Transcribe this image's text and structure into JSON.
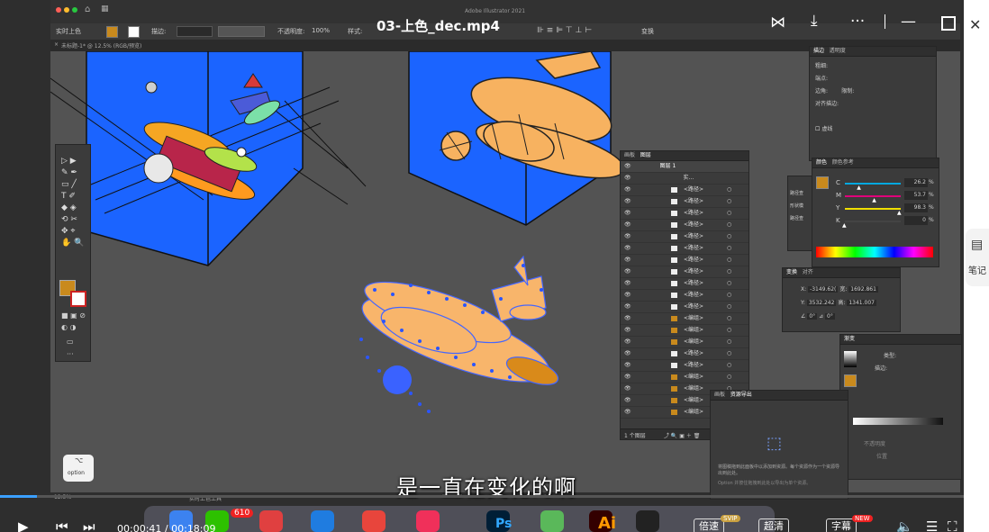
{
  "video": {
    "title": "03-上色_dec.mp4",
    "subtitle": "是一直在变化的啊",
    "time_current": "00:00:41",
    "time_total": "00:18:09",
    "progress": 0.038,
    "buttons": {
      "speed": "倍速",
      "quality": "超清",
      "quality_badge": "SVIP",
      "caption": "字幕",
      "caption_badge": "NEW"
    },
    "side_label": "笔记"
  },
  "illustrator": {
    "app_title": "Adobe Illustrator 2021",
    "control_bar": {
      "tool_label": "实时上色",
      "stroke_label": "描边:",
      "opacity_label": "不透明度:",
      "opacity_value": "100%",
      "style_label": "样式:",
      "transform_label": "变换"
    },
    "doc_tab": "未标题-1* @ 12.5% (RGB/预览)",
    "zoom": "12.5%",
    "status_tool": "实时上色工具",
    "layers_panel": {
      "tabs": [
        "画板",
        "图层"
      ],
      "top_layer": "图层 1",
      "sub_layer": "实...",
      "rows": [
        "<路径>",
        "<路径>",
        "<路径>",
        "<路径>",
        "<路径>",
        "<路径>",
        "<路径>",
        "<路径>",
        "<路径>",
        "<路径>",
        "<路径>",
        "<编组>",
        "<编组>",
        "<编组>",
        "<路径>",
        "<路径>",
        "<编组>",
        "<编组>",
        "<编组>",
        "<编组>"
      ],
      "footer": "1 个图层"
    },
    "color_panel": {
      "tabs": [
        "颜色",
        "颜色参考"
      ],
      "channels": [
        {
          "label": "C",
          "value": "26.2",
          "color": "#00a8e0"
        },
        {
          "label": "M",
          "value": "53.7",
          "color": "#e0007a"
        },
        {
          "label": "Y",
          "value": "98.3",
          "color": "#f0e000"
        },
        {
          "label": "K",
          "value": "0",
          "color": "#444444"
        }
      ],
      "unit": "%"
    },
    "stroke_panel": {
      "tabs": [
        "描边",
        "透明度"
      ],
      "weight_label": "粗细:",
      "cap_label": "端点:",
      "corner_label": "边角:",
      "limit_label": "限制:",
      "align_label": "对齐描边:",
      "dashed_label": "虚线"
    },
    "transform_panel": {
      "tabs": [
        "变换",
        "对齐"
      ],
      "x_label": "X:",
      "x_value": "-3149.62(",
      "y_label": "Y:",
      "y_value": "3532.242",
      "w_label": "宽:",
      "w_value": "1692.861",
      "h_label": "高:",
      "h_value": "1341.007",
      "angle_value": "0°",
      "shear_value": "0°"
    },
    "pathfinder_panel": {
      "labels": [
        "路径查",
        "形状模",
        "路径查"
      ]
    },
    "gradient_panel": {
      "tab": "渐变",
      "type_label": "类型:",
      "stroke_label": "描边:",
      "opacity_label": "不透明度",
      "location_label": "位置"
    },
    "asset_panel": {
      "tabs": [
        "画板",
        "资源导出"
      ],
      "hint1": "将图稿拖到此面板中以添加到资源。每个资源作为一个资源导出到此处。",
      "hint2": "Option 并按住拖拽到此处以导出为单个资源。"
    },
    "toolbox": {
      "option_label": "option"
    }
  },
  "dock": {
    "badge_count": "610",
    "apps": [
      {
        "name": "finder",
        "color": "#3c82f0"
      },
      {
        "name": "wechat",
        "color": "#2dc100"
      },
      {
        "name": "launchpad",
        "color": "#e04040"
      },
      {
        "name": "safari",
        "color": "#1f7ce0"
      },
      {
        "name": "chrome",
        "color": "#e8453c"
      },
      {
        "name": "music",
        "color": "#f0305a"
      },
      {
        "name": "photoshop",
        "color": "#001e36"
      },
      {
        "name": "maps",
        "color": "#5ab85a"
      },
      {
        "name": "illustrator",
        "color": "#330000"
      },
      {
        "name": "photos",
        "color": "#222222"
      }
    ],
    "ps_label": "Ps",
    "ai_label": "Ai"
  },
  "colors": {
    "artboard_blue": "#1b64ff",
    "plane_orange": "#f7b260",
    "accent": "#3ba0ff"
  }
}
